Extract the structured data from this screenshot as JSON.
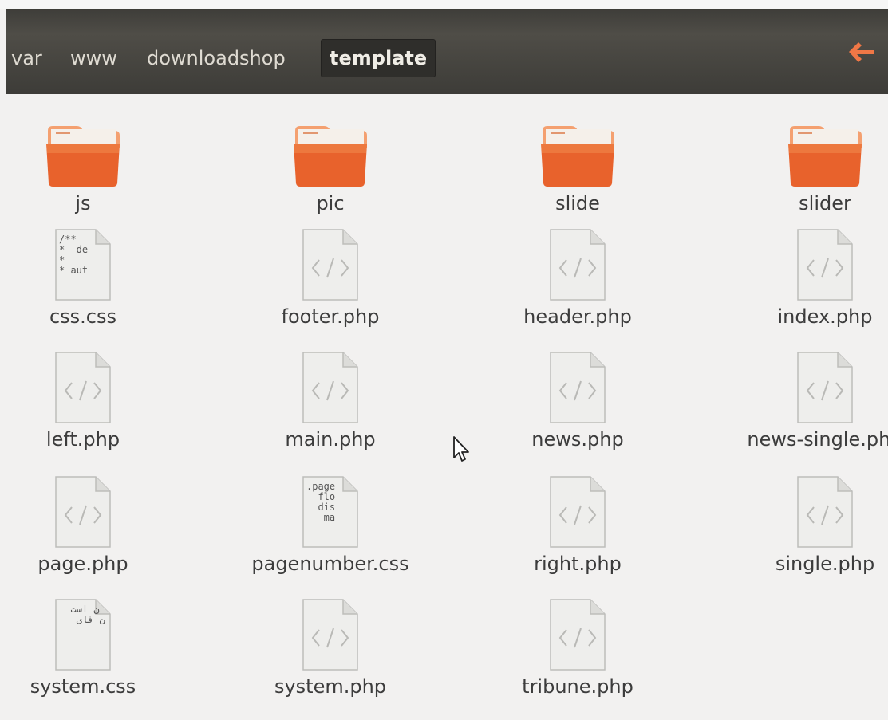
{
  "pathbar": {
    "crumbs": [
      "var",
      "www",
      "downloadshop",
      "template"
    ],
    "active_index": 3,
    "back_icon": "back-arrow-icon",
    "accent_color": "#f07746"
  },
  "files": [
    {
      "name": "js",
      "type": "folder"
    },
    {
      "name": "pic",
      "type": "folder"
    },
    {
      "name": "slide",
      "type": "folder"
    },
    {
      "name": "slider",
      "type": "folder"
    },
    {
      "name": "css.css",
      "type": "text",
      "preview": "/**\n*  de\n*\n* aut"
    },
    {
      "name": "footer.php",
      "type": "code"
    },
    {
      "name": "header.php",
      "type": "code"
    },
    {
      "name": "index.php",
      "type": "code"
    },
    {
      "name": "left.php",
      "type": "code"
    },
    {
      "name": "main.php",
      "type": "code"
    },
    {
      "name": "news.php",
      "type": "code"
    },
    {
      "name": "news-single.php",
      "type": "code"
    },
    {
      "name": "page.php",
      "type": "code"
    },
    {
      "name": "pagenumber.css",
      "type": "text",
      "preview": ".page\n  flo\n  dis\n   ma"
    },
    {
      "name": "right.php",
      "type": "code"
    },
    {
      "name": "single.php",
      "type": "code"
    },
    {
      "name": "system.css",
      "type": "text",
      "preview": "  ن است\n   ن فای"
    },
    {
      "name": "system.php",
      "type": "code"
    },
    {
      "name": "tribune.php",
      "type": "code"
    }
  ],
  "colors": {
    "folder_top": "#f4a070",
    "folder_body": "#e8622c",
    "doc_fill": "#eeeeec",
    "code_glyph": "#b9b9b6"
  }
}
